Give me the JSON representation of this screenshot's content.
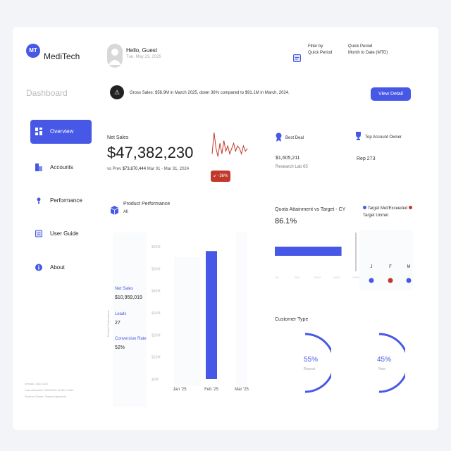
{
  "brand": {
    "initials": "MT",
    "name": "MediTech"
  },
  "header": {
    "greeting": "Hello, Guest",
    "date": "Tue, May 23, 2025",
    "filter_by_label": "Filter by",
    "filter_by_value": "Quick Period",
    "quick_period_label": "Quick Period",
    "quick_period_value": "Month to Date (MTD)"
  },
  "page_title": "Dashboard",
  "alert": {
    "text": "Gross Sales: $58.9M in March 2025, down 36% compared to $91.1M in March, 2024.",
    "button": "View Detail"
  },
  "sidebar": {
    "items": [
      {
        "label": "Overview",
        "icon": "grid-icon"
      },
      {
        "label": "Accounts",
        "icon": "building-icon"
      },
      {
        "label": "Performance",
        "icon": "bulb-icon"
      },
      {
        "label": "User Guide",
        "icon": "book-icon"
      },
      {
        "label": "About",
        "icon": "info-icon"
      }
    ],
    "meta": [
      "Version: 2023.04.2",
      "Last refreshed: 4/25/2025 11:55:13 AM",
      "Product Owner: Samuel Apostolo"
    ]
  },
  "net_sales": {
    "label": "Net Sales",
    "value": "$47,382,230",
    "vs_label": "vs Prev",
    "prev": "$73,870,444",
    "period": "Mar 01 - Mar 31, 2024",
    "change": "-36%"
  },
  "best_deal": {
    "label": "Best Deal",
    "value": "$1,605,211",
    "account": "Research Lab 65"
  },
  "top_owner": {
    "label": "Top Account Owner",
    "value": "Rep 273"
  },
  "product_perf": {
    "title": "Product Performance",
    "filter": "All",
    "side_label": "Product Performance",
    "kpis": [
      {
        "label": "Net Sales",
        "value": "$10,959,019"
      },
      {
        "label": "Leads",
        "value": "27"
      },
      {
        "label": "Conversion Rate",
        "value": "52%"
      }
    ]
  },
  "quota": {
    "title": "Quota Attainment vs Target - CY",
    "value": "86.1%",
    "legend_met": "Target Met/Exceeded",
    "legend_unmet": "Target Unmet",
    "ticks": [
      "0M",
      "50M",
      "100M",
      "150M",
      "200M"
    ],
    "months": [
      "J",
      "F",
      "M"
    ],
    "month_status": [
      "met",
      "unmet",
      "met"
    ],
    "colors": {
      "met": "#4758e6",
      "unmet": "#c0392b"
    }
  },
  "customer_type": {
    "title": "Customer Type",
    "repeat_pct": "55%",
    "repeat_label": "Repeat",
    "new_pct": "45%",
    "new_label": "New"
  },
  "chart_data": [
    {
      "type": "bar",
      "categories": [
        "Jan '25",
        "Feb '25",
        "Mar '25"
      ],
      "values": [
        0,
        58,
        0
      ],
      "yticks": [
        "$60M",
        "$50M",
        "$40M",
        "$30M",
        "$20M",
        "$10M",
        "$0M"
      ],
      "ylim": [
        0,
        60
      ]
    },
    {
      "type": "line",
      "values": [
        2,
        10,
        4,
        1,
        6,
        2,
        7,
        3,
        5,
        2,
        4,
        6,
        3,
        5,
        4,
        2,
        5,
        3,
        4
      ]
    },
    {
      "type": "bar",
      "orientation": "horizontal",
      "values": [
        172
      ],
      "xlim": [
        0,
        200
      ]
    }
  ]
}
